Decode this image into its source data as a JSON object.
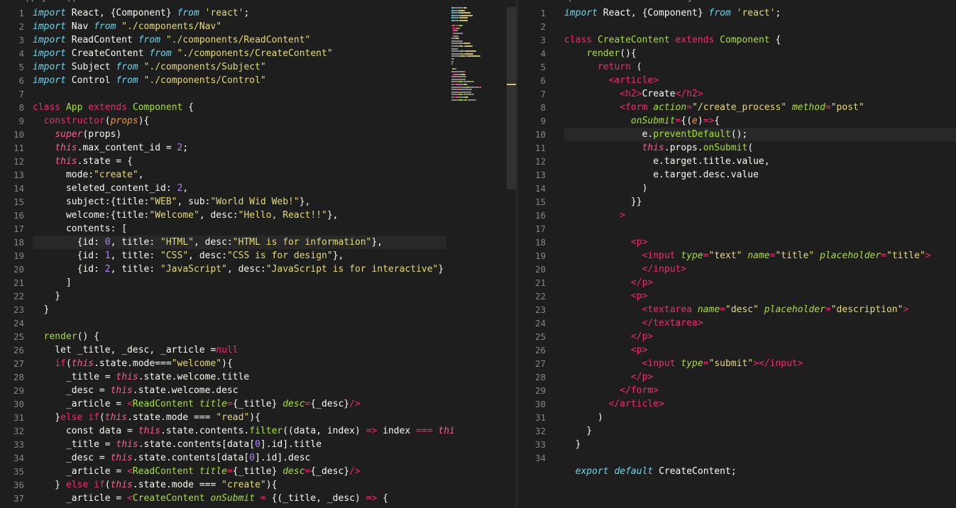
{
  "left_breadcrumb": [
    "rc",
    ">",
    "App.js",
    ">",
    "App",
    ">",
    "constructor",
    ">",
    "contents",
    ">",
    "id"
  ],
  "right_breadcrumb": [
    "src",
    ">",
    "components",
    ">",
    "CreateContent.js",
    ">",
    "CreateContent",
    ">",
    "render"
  ],
  "left_line_numbers": [
    "1",
    "2",
    "3",
    "4",
    "5",
    "6",
    "7",
    "8",
    "9",
    "10",
    "11",
    "12",
    "13",
    "14",
    "15",
    "16",
    "17",
    "18",
    "19",
    "20",
    "21",
    "22",
    "23",
    "24",
    "25",
    "26",
    "27",
    "28",
    "29",
    "30",
    "31",
    "32",
    "33",
    "34",
    "35",
    "36",
    "37"
  ],
  "right_line_numbers": [
    "1",
    "2",
    "3",
    "4",
    "5",
    "6",
    "7",
    "8",
    "9",
    "10",
    "11",
    "12",
    "13",
    "14",
    "15",
    "16",
    "17",
    "18",
    "19",
    "20",
    "21",
    "22",
    "23",
    "24",
    "25",
    "26",
    "27",
    "28",
    "29",
    "30",
    "31",
    "32",
    "33",
    "34"
  ],
  "left_lines": [
    [
      [
        "it",
        "import"
      ],
      [
        "pl",
        " React, {Component} "
      ],
      [
        "it",
        "from"
      ],
      [
        "pl",
        " "
      ],
      [
        "st",
        "'react'"
      ],
      [
        "pl",
        ";"
      ]
    ],
    [
      [
        "it",
        "import"
      ],
      [
        "pl",
        " Nav "
      ],
      [
        "it",
        "from"
      ],
      [
        "pl",
        " "
      ],
      [
        "st",
        "\"./components/Nav\""
      ]
    ],
    [
      [
        "it",
        "import"
      ],
      [
        "pl",
        " ReadContent "
      ],
      [
        "it",
        "from"
      ],
      [
        "pl",
        " "
      ],
      [
        "st",
        "\"./components/ReadContent\""
      ]
    ],
    [
      [
        "it",
        "import"
      ],
      [
        "pl",
        " CreateContent "
      ],
      [
        "it",
        "from"
      ],
      [
        "pl",
        " "
      ],
      [
        "st",
        "\"./components/CreateContent\""
      ]
    ],
    [
      [
        "it",
        "import"
      ],
      [
        "pl",
        " Subject "
      ],
      [
        "it",
        "from"
      ],
      [
        "pl",
        " "
      ],
      [
        "st",
        "\"./components/Subject\""
      ]
    ],
    [
      [
        "it",
        "import"
      ],
      [
        "pl",
        " Control "
      ],
      [
        "it",
        "from"
      ],
      [
        "pl",
        " "
      ],
      [
        "st",
        "\"./components/Control\""
      ]
    ],
    [
      [
        "pl",
        ""
      ]
    ],
    [
      [
        "kw",
        "class"
      ],
      [
        "pl",
        " "
      ],
      [
        "cl",
        "App"
      ],
      [
        "pl",
        " "
      ],
      [
        "kw",
        "extends"
      ],
      [
        "pl",
        " "
      ],
      [
        "cl",
        "Component"
      ],
      [
        "pl",
        " {"
      ]
    ],
    [
      [
        "pl",
        "  "
      ],
      [
        "kw",
        "constructor"
      ],
      [
        "pl",
        "("
      ],
      [
        "pr",
        "props"
      ],
      [
        "pl",
        "){"
      ]
    ],
    [
      [
        "pl",
        "    "
      ],
      [
        "th",
        "super"
      ],
      [
        "pl",
        "(props)"
      ]
    ],
    [
      [
        "pl",
        "    "
      ],
      [
        "th",
        "this"
      ],
      [
        "pl",
        ".max_content_id = "
      ],
      [
        "nu",
        "2"
      ],
      [
        "pl",
        ";"
      ]
    ],
    [
      [
        "pl",
        "    "
      ],
      [
        "th",
        "this"
      ],
      [
        "pl",
        ".state = {"
      ]
    ],
    [
      [
        "pl",
        "      mode:"
      ],
      [
        "st",
        "\"create\""
      ],
      [
        "pl",
        ","
      ]
    ],
    [
      [
        "pl",
        "      seleted_content_id: "
      ],
      [
        "nu",
        "2"
      ],
      [
        "pl",
        ","
      ]
    ],
    [
      [
        "pl",
        "      subject:{title:"
      ],
      [
        "st",
        "\"WEB\""
      ],
      [
        "pl",
        ", sub:"
      ],
      [
        "st",
        "\"World Wid Web!\""
      ],
      [
        "pl",
        "},"
      ]
    ],
    [
      [
        "pl",
        "      welcome:{title:"
      ],
      [
        "st",
        "\"Welcome\""
      ],
      [
        "pl",
        ", desc:"
      ],
      [
        "st",
        "\"Hello, React!!\""
      ],
      [
        "pl",
        "},"
      ]
    ],
    [
      [
        "pl",
        "      contents: ["
      ]
    ],
    [
      [
        "pl",
        "        {id: "
      ],
      [
        "nu",
        "0"
      ],
      [
        "pl",
        ", title: "
      ],
      [
        "st",
        "\"HTML\""
      ],
      [
        "pl",
        ", desc:"
      ],
      [
        "st",
        "\"HTML is for information\""
      ],
      [
        "pl",
        "},"
      ]
    ],
    [
      [
        "pl",
        "        {id: "
      ],
      [
        "nu",
        "1"
      ],
      [
        "pl",
        ", title: "
      ],
      [
        "st",
        "\"CSS\""
      ],
      [
        "pl",
        ", desc:"
      ],
      [
        "st",
        "\"CSS is for design\""
      ],
      [
        "pl",
        "},"
      ]
    ],
    [
      [
        "pl",
        "        {id: "
      ],
      [
        "nu",
        "2"
      ],
      [
        "pl",
        ", title: "
      ],
      [
        "st",
        "\"JavaScript\""
      ],
      [
        "pl",
        ", desc:"
      ],
      [
        "st",
        "\"JavaScript is for interactive\""
      ],
      [
        "pl",
        "}"
      ]
    ],
    [
      [
        "pl",
        "      ]"
      ]
    ],
    [
      [
        "pl",
        "    }"
      ]
    ],
    [
      [
        "pl",
        "  }"
      ]
    ],
    [
      [
        "pl",
        ""
      ]
    ],
    [
      [
        "pl",
        "  "
      ],
      [
        "fn",
        "render"
      ],
      [
        "pl",
        "() {"
      ]
    ],
    [
      [
        "pl",
        "    let _title, _desc, _article ="
      ],
      [
        "kw",
        "null"
      ]
    ],
    [
      [
        "pl",
        "    "
      ],
      [
        "kw",
        "if"
      ],
      [
        "pl",
        "("
      ],
      [
        "th",
        "this"
      ],
      [
        "pl",
        ".state.mode==="
      ],
      [
        "st",
        "\"welcome\""
      ],
      [
        "pl",
        "){"
      ]
    ],
    [
      [
        "pl",
        "      _title = "
      ],
      [
        "th",
        "this"
      ],
      [
        "pl",
        ".state.welcome.title"
      ]
    ],
    [
      [
        "pl",
        "      _desc = "
      ],
      [
        "th",
        "this"
      ],
      [
        "pl",
        ".state.welcome.desc"
      ]
    ],
    [
      [
        "pl",
        "      _article = "
      ],
      [
        "tg",
        "<"
      ],
      [
        "cl",
        "ReadContent"
      ],
      [
        "pl",
        " "
      ],
      [
        "at",
        "title"
      ],
      [
        "tg",
        "="
      ],
      [
        "pl",
        "{_title} "
      ],
      [
        "at",
        "desc"
      ],
      [
        "tg",
        "="
      ],
      [
        "pl",
        "{_desc}"
      ],
      [
        "tg",
        "/>"
      ]
    ],
    [
      [
        "pl",
        "    }"
      ],
      [
        "kw",
        "else if"
      ],
      [
        "pl",
        "("
      ],
      [
        "th",
        "this"
      ],
      [
        "pl",
        ".state.mode === "
      ],
      [
        "st",
        "\"read\""
      ],
      [
        "pl",
        "){"
      ]
    ],
    [
      [
        "pl",
        "      const data = "
      ],
      [
        "th",
        "this"
      ],
      [
        "pl",
        ".state.contents."
      ],
      [
        "fn",
        "filter"
      ],
      [
        "pl",
        "((data, index) "
      ],
      [
        "kw",
        "=>"
      ],
      [
        "pl",
        " index "
      ],
      [
        "kw",
        "==="
      ],
      [
        "pl",
        " "
      ],
      [
        "th",
        "thi"
      ]
    ],
    [
      [
        "pl",
        "      _title = "
      ],
      [
        "th",
        "this"
      ],
      [
        "pl",
        ".state.contents[data["
      ],
      [
        "nu",
        "0"
      ],
      [
        "pl",
        "].id].title"
      ]
    ],
    [
      [
        "pl",
        "      _desc = "
      ],
      [
        "th",
        "this"
      ],
      [
        "pl",
        ".state.contents[data["
      ],
      [
        "nu",
        "0"
      ],
      [
        "pl",
        "].id].desc"
      ]
    ],
    [
      [
        "pl",
        "      _article = "
      ],
      [
        "tg",
        "<"
      ],
      [
        "cl",
        "ReadContent"
      ],
      [
        "pl",
        " "
      ],
      [
        "at",
        "title"
      ],
      [
        "tg",
        "="
      ],
      [
        "pl",
        "{_title} "
      ],
      [
        "at",
        "desc"
      ],
      [
        "tg",
        "="
      ],
      [
        "pl",
        "{_desc}"
      ],
      [
        "tg",
        "/>"
      ]
    ],
    [
      [
        "pl",
        "    } "
      ],
      [
        "kw",
        "else if"
      ],
      [
        "pl",
        "("
      ],
      [
        "th",
        "this"
      ],
      [
        "pl",
        ".state.mode === "
      ],
      [
        "st",
        "\"create\""
      ],
      [
        "pl",
        "){"
      ]
    ],
    [
      [
        "pl",
        "      _article = "
      ],
      [
        "tg",
        "<"
      ],
      [
        "cl",
        "CreateContent"
      ],
      [
        "pl",
        " "
      ],
      [
        "at",
        "onSubmit"
      ],
      [
        "pl",
        " "
      ],
      [
        "tg",
        "="
      ],
      [
        "pl",
        " {(_title, _desc) "
      ],
      [
        "kw",
        "=>"
      ],
      [
        "pl",
        " {"
      ]
    ]
  ],
  "right_lines": [
    [
      [
        "it",
        "import"
      ],
      [
        "pl",
        " React, {Component} "
      ],
      [
        "it",
        "from"
      ],
      [
        "pl",
        " "
      ],
      [
        "st",
        "'react'"
      ],
      [
        "pl",
        ";"
      ]
    ],
    [
      [
        "pl",
        ""
      ]
    ],
    [
      [
        "kw",
        "class"
      ],
      [
        "pl",
        " "
      ],
      [
        "cl",
        "CreateContent"
      ],
      [
        "pl",
        " "
      ],
      [
        "kw",
        "extends"
      ],
      [
        "pl",
        " "
      ],
      [
        "cl",
        "Component"
      ],
      [
        "pl",
        " {"
      ]
    ],
    [
      [
        "pl",
        "    "
      ],
      [
        "fn",
        "render"
      ],
      [
        "pl",
        "(){"
      ]
    ],
    [
      [
        "pl",
        "      "
      ],
      [
        "kw",
        "return"
      ],
      [
        "pl",
        " ("
      ]
    ],
    [
      [
        "pl",
        "        "
      ],
      [
        "tg",
        "<article>"
      ]
    ],
    [
      [
        "pl",
        "          "
      ],
      [
        "tg",
        "<h2>"
      ],
      [
        "pl",
        "Create"
      ],
      [
        "tg",
        "</h2>"
      ]
    ],
    [
      [
        "pl",
        "          "
      ],
      [
        "tg",
        "<form"
      ],
      [
        "pl",
        " "
      ],
      [
        "at",
        "action"
      ],
      [
        "tg",
        "="
      ],
      [
        "st",
        "\"/create_process\""
      ],
      [
        "pl",
        " "
      ],
      [
        "at",
        "method"
      ],
      [
        "tg",
        "="
      ],
      [
        "st",
        "\"post\""
      ]
    ],
    [
      [
        "pl",
        "            "
      ],
      [
        "at",
        "onSubmit"
      ],
      [
        "tg",
        "="
      ],
      [
        "pl",
        "{("
      ],
      [
        "pr",
        "e"
      ],
      [
        "pl",
        ")"
      ],
      [
        "kw",
        "=>"
      ],
      [
        "pl",
        "{"
      ]
    ],
    [
      [
        "pl",
        "              e."
      ],
      [
        "fn",
        "preventDefault"
      ],
      [
        "pl",
        "();"
      ]
    ],
    [
      [
        "pl",
        "              "
      ],
      [
        "th",
        "this"
      ],
      [
        "pl",
        ".props."
      ],
      [
        "fn",
        "onSubmit"
      ],
      [
        "pl",
        "("
      ]
    ],
    [
      [
        "pl",
        "                e.target.title.value,"
      ]
    ],
    [
      [
        "pl",
        "                e.target.desc.value"
      ]
    ],
    [
      [
        "pl",
        "              )"
      ]
    ],
    [
      [
        "pl",
        "            }}"
      ]
    ],
    [
      [
        "pl",
        "          "
      ],
      [
        "tg",
        ">"
      ]
    ],
    [
      [
        "pl",
        ""
      ]
    ],
    [
      [
        "pl",
        "            "
      ],
      [
        "tg",
        "<p>"
      ]
    ],
    [
      [
        "pl",
        "              "
      ],
      [
        "tg",
        "<input"
      ],
      [
        "pl",
        " "
      ],
      [
        "at",
        "type"
      ],
      [
        "tg",
        "="
      ],
      [
        "st",
        "\"text\""
      ],
      [
        "pl",
        " "
      ],
      [
        "at",
        "name"
      ],
      [
        "tg",
        "="
      ],
      [
        "st",
        "\"title\""
      ],
      [
        "pl",
        " "
      ],
      [
        "at",
        "placeholder"
      ],
      [
        "tg",
        "="
      ],
      [
        "st",
        "\"title\""
      ],
      [
        "tg",
        ">"
      ]
    ],
    [
      [
        "pl",
        "              "
      ],
      [
        "tg",
        "</input>"
      ]
    ],
    [
      [
        "pl",
        "            "
      ],
      [
        "tg",
        "</p>"
      ]
    ],
    [
      [
        "pl",
        "            "
      ],
      [
        "tg",
        "<p>"
      ]
    ],
    [
      [
        "pl",
        "              "
      ],
      [
        "tg",
        "<textarea"
      ],
      [
        "pl",
        " "
      ],
      [
        "at",
        "name"
      ],
      [
        "tg",
        "="
      ],
      [
        "st",
        "\"desc\""
      ],
      [
        "pl",
        " "
      ],
      [
        "at",
        "placeholder"
      ],
      [
        "tg",
        "="
      ],
      [
        "st",
        "\"description\""
      ],
      [
        "tg",
        ">"
      ]
    ],
    [
      [
        "pl",
        "              "
      ],
      [
        "tg",
        "</textarea>"
      ]
    ],
    [
      [
        "pl",
        "            "
      ],
      [
        "tg",
        "</p>"
      ]
    ],
    [
      [
        "pl",
        "            "
      ],
      [
        "tg",
        "<p>"
      ]
    ],
    [
      [
        "pl",
        "              "
      ],
      [
        "tg",
        "<input"
      ],
      [
        "pl",
        " "
      ],
      [
        "at",
        "type"
      ],
      [
        "tg",
        "="
      ],
      [
        "st",
        "\"submit\""
      ],
      [
        "tg",
        "></input>"
      ]
    ],
    [
      [
        "pl",
        "            "
      ],
      [
        "tg",
        "</p>"
      ]
    ],
    [
      [
        "pl",
        "          "
      ],
      [
        "tg",
        "</form>"
      ]
    ],
    [
      [
        "pl",
        "        "
      ],
      [
        "tg",
        "</article>"
      ]
    ],
    [
      [
        "pl",
        "      )"
      ]
    ],
    [
      [
        "pl",
        "    }"
      ]
    ],
    [
      [
        "pl",
        "  }"
      ]
    ],
    [
      [
        "pl",
        ""
      ]
    ],
    [
      [
        "pl",
        "  "
      ],
      [
        "it",
        "export"
      ],
      [
        "pl",
        " "
      ],
      [
        "it",
        "default"
      ],
      [
        "pl",
        " CreateContent;"
      ]
    ]
  ]
}
